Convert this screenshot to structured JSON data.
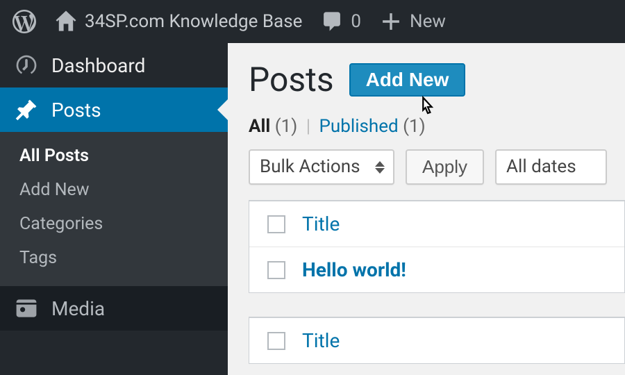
{
  "adminbar": {
    "site_title": "34SP.com Knowledge Base",
    "comments_count": "0",
    "new_label": "New"
  },
  "sidebar": {
    "dashboard": "Dashboard",
    "posts": "Posts",
    "posts_sub": {
      "all": "All Posts",
      "add_new": "Add New",
      "categories": "Categories",
      "tags": "Tags"
    },
    "media": "Media"
  },
  "page": {
    "title": "Posts",
    "add_new": "Add New"
  },
  "filters": {
    "all_label": "All",
    "all_count": "(1)",
    "published_label": "Published",
    "published_count": "(1)",
    "bulk_actions": "Bulk Actions",
    "apply": "Apply",
    "all_dates": "All dates"
  },
  "table": {
    "title_header": "Title",
    "rows": [
      {
        "title": "Hello world!"
      }
    ],
    "footer_title": "Title"
  }
}
